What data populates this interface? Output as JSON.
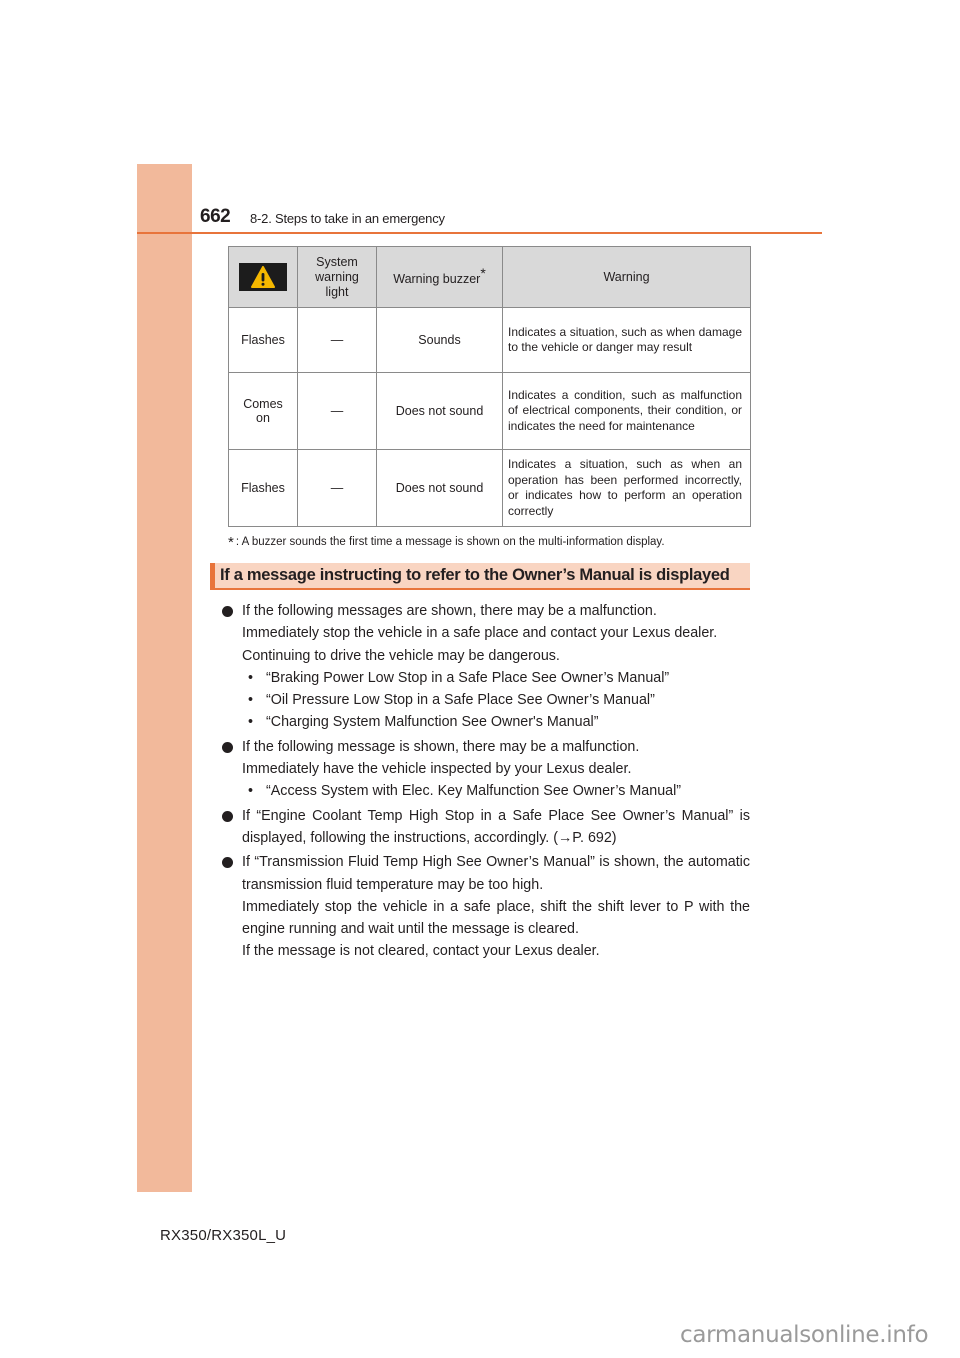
{
  "header": {
    "page_number": "662",
    "section": "8-2. Steps to take in an emergency"
  },
  "table": {
    "header": {
      "icon": "warning-triangle-icon",
      "system_light": "System warning light",
      "buzzer": "Warning buzzer",
      "buzzer_mark": "*",
      "warning": "Warning"
    },
    "rows": [
      {
        "icon_state": "Flashes",
        "system_light": "—",
        "buzzer": "Sounds",
        "warning": "Indicates a situation, such as when damage to the vehicle or danger may result"
      },
      {
        "icon_state": "Comes on",
        "system_light": "—",
        "buzzer": "Does not sound",
        "warning": "Indicates a condition, such as malfunction of electrical components, their condition, or indicates the need for maintenance"
      },
      {
        "icon_state": "Flashes",
        "system_light": "—",
        "buzzer": "Does not sound",
        "warning": "Indicates a situation, such as when an operation has been performed incorrectly, or indicates how to perform an operation correctly"
      }
    ],
    "footnote_mark": "*",
    "footnote": ": A buzzer sounds the first time a message is shown on the multi-information display."
  },
  "section_heading": "If a message instructing to refer to the Owner’s Manual is displayed",
  "bullets": [
    {
      "lines": [
        "If the following messages are shown, there may be a malfunction.",
        "Immediately stop the vehicle in a safe place and contact your Lexus dealer.",
        "Continuing to drive the vehicle may be dangerous."
      ],
      "sub_items": [
        "“Braking Power Low Stop in a Safe Place See Owner’s Manual”",
        "“Oil Pressure Low Stop in a Safe Place See Owner’s Manual”",
        "“Charging System Malfunction See Owner's Manual”"
      ]
    },
    {
      "lines": [
        "If the following message is shown, there may be a malfunction.",
        "Immediately have the vehicle inspected by your Lexus dealer."
      ],
      "sub_items": [
        "“Access System with Elec. Key Malfunction See Owner’s Manual”"
      ]
    },
    {
      "lines": [
        "If “Engine Coolant Temp High Stop in a Safe Place See Owner’s Manual” is displayed, following the instructions, accordingly. (→P. 692)"
      ],
      "sub_items": []
    },
    {
      "lines": [
        "If “Transmission Fluid Temp High See Owner’s Manual” is shown, the automatic transmission fluid temperature may be too high.",
        "Immediately stop the vehicle in a safe place, shift the shift lever to P with the engine running and wait until the message is cleared.",
        "If the message is not cleared, contact your Lexus dealer."
      ],
      "sub_items": []
    }
  ],
  "sub_bullet_glyph": "•",
  "footer": {
    "model": "RX350/RX350L_U",
    "watermark": "carmanualsonline.info"
  },
  "colors": {
    "accent": "#e8743b",
    "sidebar": "#f2b99b",
    "heading_fill": "#f9d5c2",
    "table_header": "#d9d9d9",
    "warning_icon_fill": "#f5b800"
  }
}
